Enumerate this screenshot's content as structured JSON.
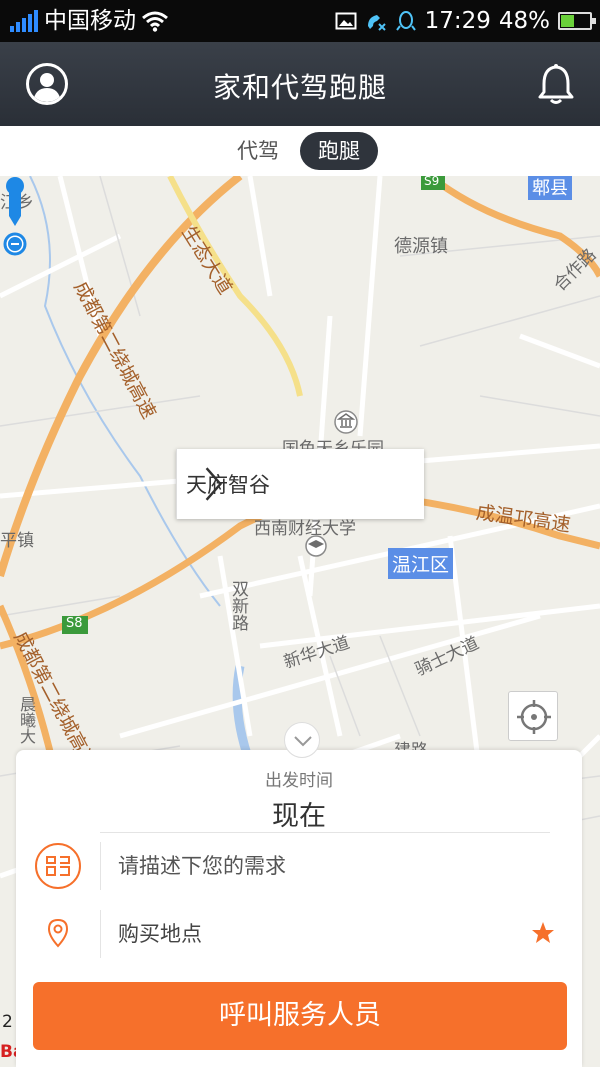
{
  "status_bar": {
    "carrier": "中国移动",
    "time": "17:29",
    "battery_percent": "48%",
    "battery_level": 0.48
  },
  "header": {
    "title": "家和代驾跑腿",
    "avatar_icon": "user-avatar-icon",
    "bell_icon": "bell-icon"
  },
  "tabs": [
    {
      "label": "代驾",
      "selected": false
    },
    {
      "label": "跑腿",
      "selected": true
    }
  ],
  "map": {
    "popup_location": "天府智谷",
    "labels": {
      "jiangxiang": "江乡",
      "deyuan": "德源镇",
      "hezuo": "合作路",
      "pixian": "郫县",
      "wenjiang": "温江区",
      "pingzhen": "平镇",
      "chenxi": "晨曦大",
      "guose": "国色天乡乐园",
      "xinan": "西南财经大学",
      "shuangxin": "双新路",
      "xinhua": "新华大道",
      "qishi": "骑士大道",
      "jielu": "建路"
    },
    "highway_labels": {
      "ring_upper": "成都第二绕城高速",
      "ring_lower": "成都第二绕城高速",
      "shengtai": "生态大道",
      "chengwen": "成温邛高速",
      "s9": "S9",
      "s8": "S8"
    },
    "footer_num": "2",
    "baidu_logo": "Ba"
  },
  "sheet": {
    "departure_label": "出发时间",
    "departure_value": "现在",
    "need_placeholder": "请描述下您的需求",
    "buy_location_placeholder": "购买地点",
    "call_button": "呼叫服务人员"
  },
  "colors": {
    "accent": "#f6702b",
    "header_bg": "#2f343c",
    "pin": "#1e88e5"
  }
}
